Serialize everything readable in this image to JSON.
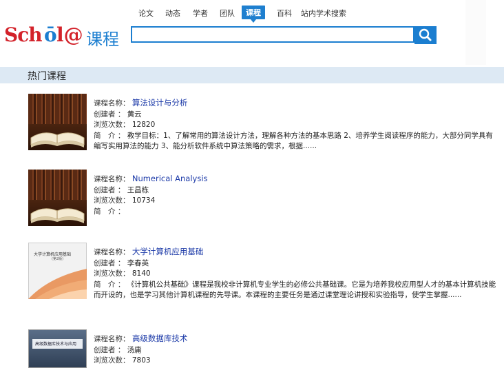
{
  "nav": [
    {
      "label": "论文",
      "active": false
    },
    {
      "label": "动态",
      "active": false
    },
    {
      "label": "学者",
      "active": false
    },
    {
      "label": "团队",
      "active": false
    },
    {
      "label": "课程",
      "active": true
    },
    {
      "label": "百科",
      "active": false
    },
    {
      "label": "站内学术搜索",
      "active": false
    }
  ],
  "logo": {
    "part1": "Sch",
    "part2": "ō",
    "part3": "l@",
    "cn": "课程"
  },
  "search": {
    "value": "",
    "placeholder": ""
  },
  "section": {
    "title": "热门课程"
  },
  "labels": {
    "name": "课程名称：",
    "creator": "创建者 ：",
    "views": "浏览次数：",
    "intro": "简　介 ："
  },
  "courses": [
    {
      "name": "算法设计与分析",
      "creator": "黄云",
      "views": "12820",
      "intro": "教学目标：1、了解常用的算法设计方法，理解各种方法的基本思路 2、培养学生阅读程序的能力，大部分同学具有编写实用算法的能力 3、能分析软件系统中算法策略的需求，根据......",
      "thumb": "book-icon"
    },
    {
      "name": "Numerical Analysis",
      "creator": "王昌栋",
      "views": "10734",
      "intro": "",
      "thumb": "book-icon"
    },
    {
      "name": "大学计算机应用基础",
      "creator": "李春英",
      "views": "8140",
      "intro": "《计算机公共基础》课程是我校非计算机专业学生的必修公共基础课。它是为培养我校应用型人才的基本计算机技能而开设的，也是学习其他计算机课程的先导课。本课程的主要任务是通过课堂理论讲授和实验指导，使学生掌握......",
      "thumb": "textbook-cover-icon",
      "cover_title": "大学计算机应用基础",
      "cover_edition": "(第2版)"
    },
    {
      "name": "高级数据库技术",
      "creator": "汤庸",
      "views": "7803",
      "intro": "",
      "thumb": "textbook-cover-icon",
      "cover_title": "高级数据库技术与应用"
    }
  ],
  "colors": {
    "accent": "#1b7ed0",
    "brand_red": "#d3222a",
    "section_bg": "#dde9f4",
    "link": "#1c3aa8"
  }
}
